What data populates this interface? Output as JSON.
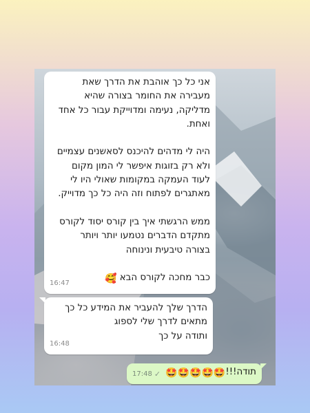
{
  "messages": [
    {
      "direction": "incoming",
      "text": "אני כל כך אוהבת את הדרך שאת\nמעבירה את החומר בצורה שהיא\nמדליקה, נעימה ומדוייקת עבור כל אחד\nואחת.\n\nהיה לי מדהים להיכנס לסאשנים עצמיים\nולא רק בזוגות איפשר לי המון מקום\nלעוד העמקה במקומות שאולי היו לי\nמאתגרים לפתוח וזה היה כל כך מדוייק.\n\nממש הרגשתי איך בין קורס יסוד לקורס\nמתקדם הדברים נטמעו יותר ויותר\nבצורה טיבעית ונינוחה\n\nכבר מחכה לקורס הבא",
      "emoji": "🥰",
      "time": "16:47"
    },
    {
      "direction": "incoming",
      "text": "הדרך שלך להעביר את המידע כל כך\nמתאים לדרך שלי לספוג\nותודה על כך",
      "time": "16:48"
    },
    {
      "direction": "outgoing",
      "text": "תודה!!!",
      "emoji": "🤩🤩🤩🤩🤩",
      "time": "17:48",
      "status": "✓"
    }
  ],
  "icons": {
    "sent_status": "check-icon"
  },
  "colors": {
    "incoming_bubble": "#ffffff",
    "outgoing_bubble": "#dcf8c6"
  }
}
